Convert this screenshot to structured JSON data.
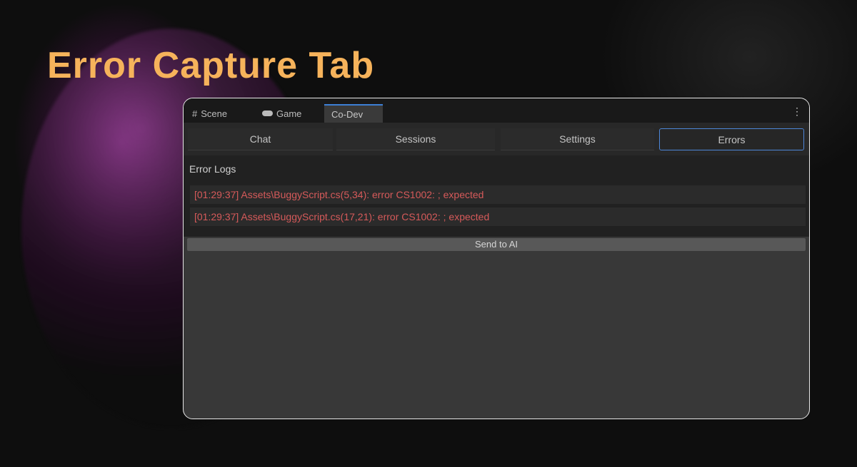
{
  "heading": "Error Capture Tab",
  "window": {
    "tabs": [
      {
        "label": "Scene",
        "icon": "grid-icon"
      },
      {
        "label": "Game",
        "icon": "gamepad-icon"
      },
      {
        "label": "Co-Dev",
        "active": true
      }
    ],
    "toolbar": [
      "Chat",
      "Sessions",
      "Settings",
      "Errors"
    ],
    "selected": "Errors",
    "section_title": "Error Logs",
    "errors": [
      "[01:29:37] Assets\\BuggyScript.cs(5,34): error CS1002: ; expected",
      "[01:29:37] Assets\\BuggyScript.cs(17,21): error CS1002: ; expected"
    ],
    "send_button": "Send to AI"
  },
  "colors": {
    "accent": "#f6b35b",
    "error": "#d65a5a",
    "selection": "#4d86d8"
  }
}
